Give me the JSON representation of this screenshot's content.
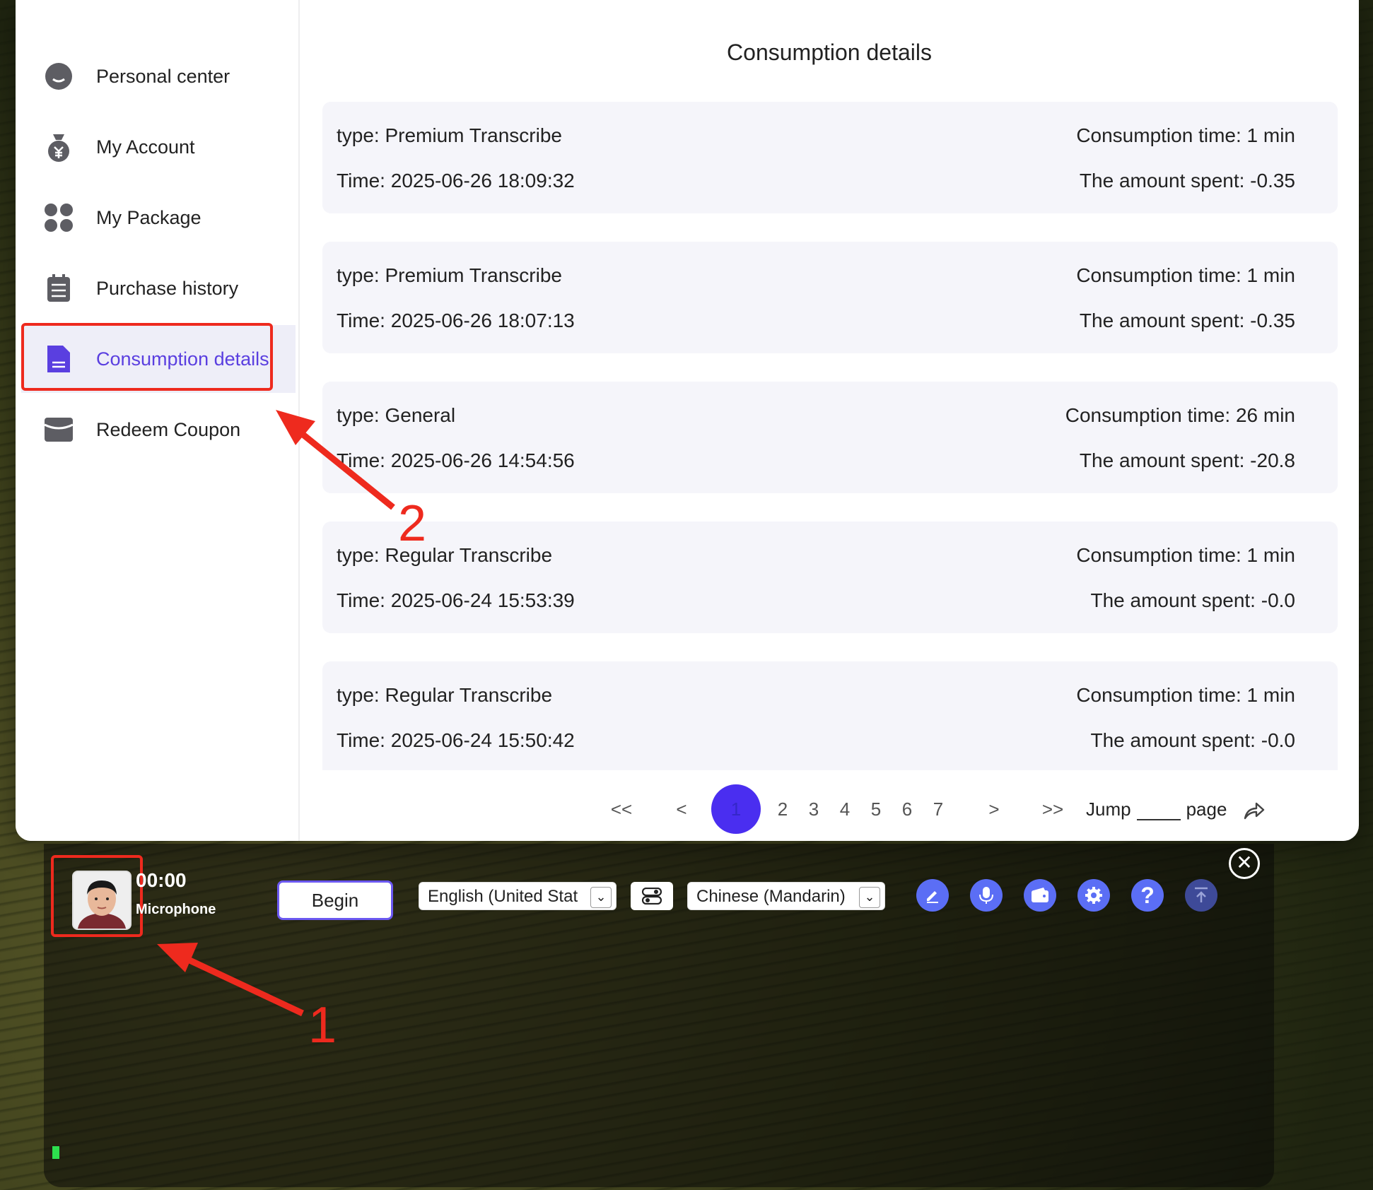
{
  "sidebar": {
    "items": [
      {
        "label": "Personal center",
        "icon": "person-icon"
      },
      {
        "label": "My Account",
        "icon": "money-bag-icon"
      },
      {
        "label": "My Package",
        "icon": "grid-icon"
      },
      {
        "label": "Purchase history",
        "icon": "clipboard-icon"
      },
      {
        "label": "Consumption details",
        "icon": "document-icon",
        "active": true
      },
      {
        "label": "Redeem Coupon",
        "icon": "coupon-icon"
      }
    ]
  },
  "main": {
    "title": "Consumption details",
    "records": [
      {
        "type": "type: Premium Transcribe",
        "time": "Time: 2025-06-26 18:09:32",
        "duration": "Consumption time: 1 min",
        "amount": "The amount spent: -0.35"
      },
      {
        "type": "type: Premium Transcribe",
        "time": "Time: 2025-06-26 18:07:13",
        "duration": "Consumption time: 1 min",
        "amount": "The amount spent: -0.35"
      },
      {
        "type": "type: General",
        "time": "Time: 2025-06-26 14:54:56",
        "duration": "Consumption time: 26 min",
        "amount": "The amount spent: -20.8"
      },
      {
        "type": "type: Regular Transcribe",
        "time": "Time: 2025-06-24 15:53:39",
        "duration": "Consumption time: 1 min",
        "amount": "The amount spent: -0.0"
      },
      {
        "type": "type: Regular Transcribe",
        "time": "Time: 2025-06-24 15:50:42",
        "duration": "Consumption time: 1 min",
        "amount": "The amount spent: -0.0"
      }
    ]
  },
  "pagination": {
    "first": "<<",
    "prev": "<",
    "current": "1",
    "pages": [
      "2",
      "3",
      "4",
      "5",
      "6",
      "7"
    ],
    "next": ">",
    "last": ">>",
    "jump_label": "Jump",
    "page_label": "page"
  },
  "toolbar": {
    "timer": "00:00",
    "source": "Microphone",
    "begin_label": "Begin",
    "source_language": "English (United Stat",
    "target_language": "Chinese (Mandarin)",
    "accent_color": "#5b6ef5"
  },
  "annotations": {
    "label_1": "1",
    "label_2": "2",
    "color": "#ee2a1e"
  }
}
